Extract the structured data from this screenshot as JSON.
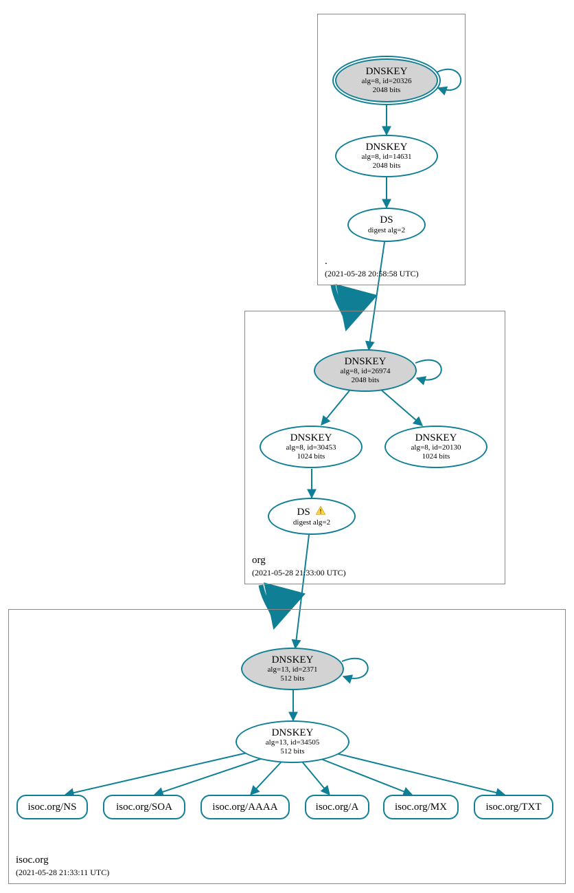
{
  "zones": {
    "root": {
      "name": ".",
      "ts": "(2021-05-28 20:58:58 UTC)"
    },
    "org": {
      "name": "org",
      "ts": "(2021-05-28 21:33:00 UTC)"
    },
    "isoc": {
      "name": "isoc.org",
      "ts": "(2021-05-28 21:33:11 UTC)"
    }
  },
  "nodes": {
    "root_ksk": {
      "title": "DNSKEY",
      "sub1": "alg=8, id=20326",
      "sub2": "2048 bits"
    },
    "root_zsk": {
      "title": "DNSKEY",
      "sub1": "alg=8, id=14631",
      "sub2": "2048 bits"
    },
    "root_ds": {
      "title": "DS",
      "sub1": "digest alg=2"
    },
    "org_ksk": {
      "title": "DNSKEY",
      "sub1": "alg=8, id=26974",
      "sub2": "2048 bits"
    },
    "org_zsk1": {
      "title": "DNSKEY",
      "sub1": "alg=8, id=30453",
      "sub2": "1024 bits"
    },
    "org_zsk2": {
      "title": "DNSKEY",
      "sub1": "alg=8, id=20130",
      "sub2": "1024 bits"
    },
    "org_ds": {
      "title": "DS",
      "sub1": "digest alg=2"
    },
    "isoc_ksk": {
      "title": "DNSKEY",
      "sub1": "alg=13, id=2371",
      "sub2": "512 bits"
    },
    "isoc_zsk": {
      "title": "DNSKEY",
      "sub1": "alg=13, id=34505",
      "sub2": "512 bits"
    }
  },
  "rr": {
    "ns": "isoc.org/NS",
    "soa": "isoc.org/SOA",
    "aaaa": "isoc.org/AAAA",
    "a": "isoc.org/A",
    "mx": "isoc.org/MX",
    "txt": "isoc.org/TXT"
  }
}
